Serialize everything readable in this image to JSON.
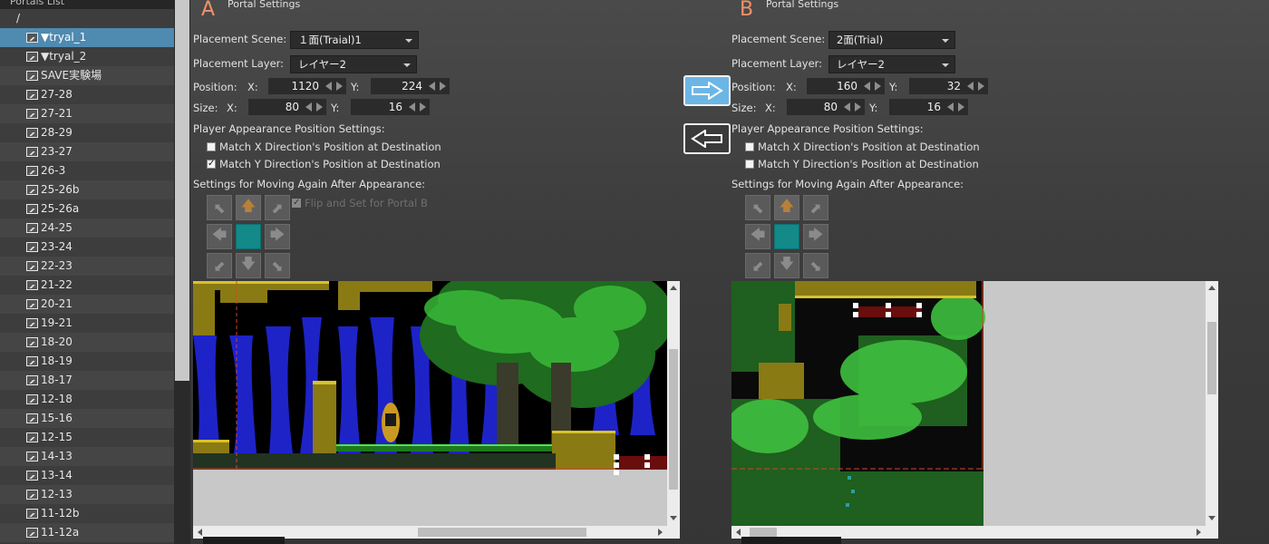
{
  "sidebar": {
    "title": "Portals List",
    "root": "/",
    "items": [
      {
        "label": "▼tryal_1",
        "selected": true
      },
      {
        "label": "▼tryal_2"
      },
      {
        "label": "SAVE実験場"
      },
      {
        "label": "27-28"
      },
      {
        "label": "27-21"
      },
      {
        "label": "28-29"
      },
      {
        "label": "23-27"
      },
      {
        "label": "26-3"
      },
      {
        "label": "25-26b"
      },
      {
        "label": "25-26a"
      },
      {
        "label": "24-25"
      },
      {
        "label": "23-24"
      },
      {
        "label": "22-23"
      },
      {
        "label": "21-22"
      },
      {
        "label": "20-21"
      },
      {
        "label": "19-21"
      },
      {
        "label": "18-20"
      },
      {
        "label": "18-19"
      },
      {
        "label": "18-17"
      },
      {
        "label": "12-18"
      },
      {
        "label": "15-16"
      },
      {
        "label": "12-15"
      },
      {
        "label": "14-13"
      },
      {
        "label": "13-14"
      },
      {
        "label": "12-13"
      },
      {
        "label": "11-12b"
      },
      {
        "label": "11-12a"
      }
    ]
  },
  "labels": {
    "portal_settings": "Portal Settings",
    "placement_scene": "Placement Scene:",
    "placement_layer": "Placement Layer:",
    "position": "Position:",
    "size": "Size:",
    "x": "X:",
    "y": "Y:",
    "player_appearance": "Player Appearance Position Settings:",
    "match_x": "Match X Direction's Position at Destination",
    "match_y": "Match Y Direction's Position at Destination",
    "moving_again": "Settings for Moving Again After Appearance:",
    "flip_set": "Flip and Set for Portal B"
  },
  "portal_a": {
    "letter": "A",
    "scene": "１面(Traial)1",
    "layer": "レイヤー2",
    "pos_x": "1120",
    "pos_y": "224",
    "size_x": "80",
    "size_y": "16",
    "match_x": false,
    "match_y": true,
    "flip_set": true
  },
  "portal_b": {
    "letter": "B",
    "scene": "2面(Trial)",
    "layer": "レイヤー2",
    "pos_x": "160",
    "pos_y": "32",
    "size_x": "80",
    "size_y": "16",
    "match_x": false,
    "match_y": false
  },
  "icons": {
    "direction_pad": [
      "arrow-up-left-icon",
      "arrow-up-icon",
      "arrow-up-right-icon",
      "arrow-left-icon",
      "center-icon",
      "arrow-right-icon",
      "arrow-down-left-icon",
      "arrow-down-icon",
      "arrow-down-right-icon"
    ],
    "copy_a_to_b": "arrow-right-icon",
    "copy_b_to_a": "arrow-left-icon"
  },
  "colors": {
    "accent_letter": "#f0926a",
    "selected_row": "#4f8ab0",
    "center_button": "#13898a",
    "active_arrow": "#b8803a",
    "copy_button_active": "#6cb6e6"
  }
}
